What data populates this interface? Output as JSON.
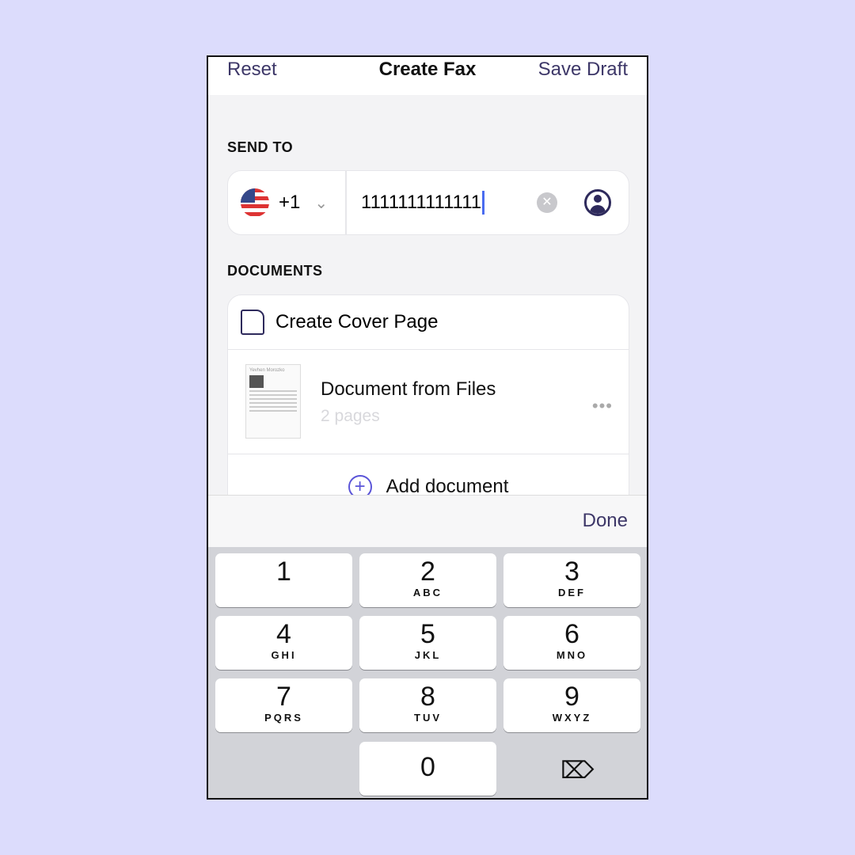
{
  "nav": {
    "reset": "Reset",
    "title": "Create Fax",
    "save_draft": "Save Draft"
  },
  "send_to": {
    "label": "SEND TO",
    "country_code": "+1",
    "number": "1111111111111"
  },
  "documents": {
    "label": "DOCUMENTS",
    "cover": "Create Cover Page",
    "doc_name": "Document from Files",
    "doc_pages": "2 pages",
    "thumb_title": "Yevhen Morozko",
    "add": "Add document"
  },
  "accessory": {
    "done": "Done"
  },
  "keypad": [
    {
      "d": "1",
      "s": ""
    },
    {
      "d": "2",
      "s": "ABC"
    },
    {
      "d": "3",
      "s": "DEF"
    },
    {
      "d": "4",
      "s": "GHI"
    },
    {
      "d": "5",
      "s": "JKL"
    },
    {
      "d": "6",
      "s": "MNO"
    },
    {
      "d": "7",
      "s": "PQRS"
    },
    {
      "d": "8",
      "s": "TUV"
    },
    {
      "d": "9",
      "s": "WXYZ"
    },
    {
      "d": "0",
      "s": ""
    }
  ]
}
